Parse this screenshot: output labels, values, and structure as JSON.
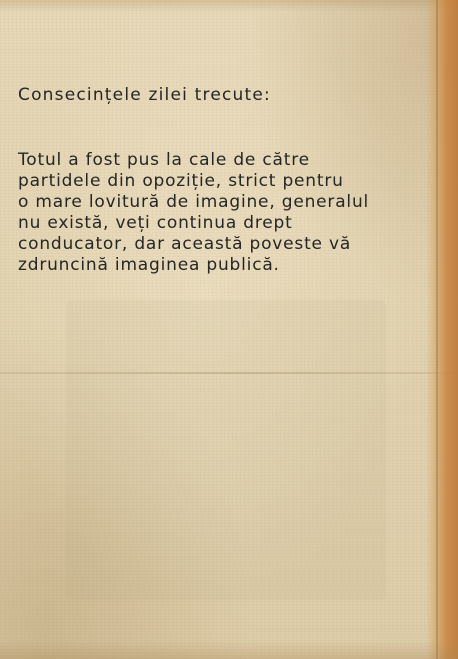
{
  "page": {
    "heading": "Consecințele zilei trecute:",
    "body": "Totul a fost pus la cale de către\npartidele din opoziție, strict pentru\no mare lovitură de imagine, generalul\nnu există, veți continua drept\nconducator, dar această poveste vă\nzdruncină imaginea publică."
  },
  "colors": {
    "paper": "#e2d3b1",
    "text": "#262626",
    "edge_accent": "#c8823c"
  }
}
